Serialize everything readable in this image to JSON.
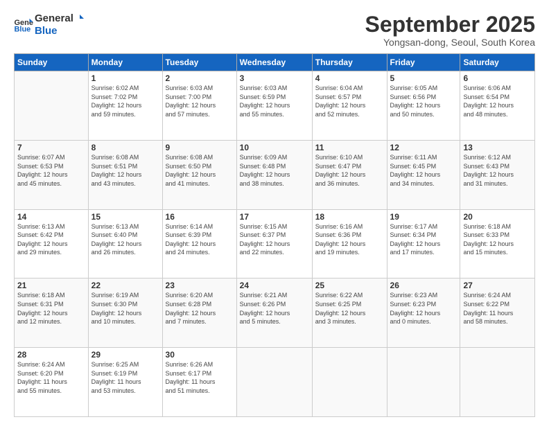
{
  "header": {
    "logo_line1": "General",
    "logo_line2": "Blue",
    "month": "September 2025",
    "location": "Yongsan-dong, Seoul, South Korea"
  },
  "days_of_week": [
    "Sunday",
    "Monday",
    "Tuesday",
    "Wednesday",
    "Thursday",
    "Friday",
    "Saturday"
  ],
  "weeks": [
    [
      {
        "day": "",
        "info": ""
      },
      {
        "day": "1",
        "info": "Sunrise: 6:02 AM\nSunset: 7:02 PM\nDaylight: 12 hours\nand 59 minutes."
      },
      {
        "day": "2",
        "info": "Sunrise: 6:03 AM\nSunset: 7:00 PM\nDaylight: 12 hours\nand 57 minutes."
      },
      {
        "day": "3",
        "info": "Sunrise: 6:03 AM\nSunset: 6:59 PM\nDaylight: 12 hours\nand 55 minutes."
      },
      {
        "day": "4",
        "info": "Sunrise: 6:04 AM\nSunset: 6:57 PM\nDaylight: 12 hours\nand 52 minutes."
      },
      {
        "day": "5",
        "info": "Sunrise: 6:05 AM\nSunset: 6:56 PM\nDaylight: 12 hours\nand 50 minutes."
      },
      {
        "day": "6",
        "info": "Sunrise: 6:06 AM\nSunset: 6:54 PM\nDaylight: 12 hours\nand 48 minutes."
      }
    ],
    [
      {
        "day": "7",
        "info": "Sunrise: 6:07 AM\nSunset: 6:53 PM\nDaylight: 12 hours\nand 45 minutes."
      },
      {
        "day": "8",
        "info": "Sunrise: 6:08 AM\nSunset: 6:51 PM\nDaylight: 12 hours\nand 43 minutes."
      },
      {
        "day": "9",
        "info": "Sunrise: 6:08 AM\nSunset: 6:50 PM\nDaylight: 12 hours\nand 41 minutes."
      },
      {
        "day": "10",
        "info": "Sunrise: 6:09 AM\nSunset: 6:48 PM\nDaylight: 12 hours\nand 38 minutes."
      },
      {
        "day": "11",
        "info": "Sunrise: 6:10 AM\nSunset: 6:47 PM\nDaylight: 12 hours\nand 36 minutes."
      },
      {
        "day": "12",
        "info": "Sunrise: 6:11 AM\nSunset: 6:45 PM\nDaylight: 12 hours\nand 34 minutes."
      },
      {
        "day": "13",
        "info": "Sunrise: 6:12 AM\nSunset: 6:43 PM\nDaylight: 12 hours\nand 31 minutes."
      }
    ],
    [
      {
        "day": "14",
        "info": "Sunrise: 6:13 AM\nSunset: 6:42 PM\nDaylight: 12 hours\nand 29 minutes."
      },
      {
        "day": "15",
        "info": "Sunrise: 6:13 AM\nSunset: 6:40 PM\nDaylight: 12 hours\nand 26 minutes."
      },
      {
        "day": "16",
        "info": "Sunrise: 6:14 AM\nSunset: 6:39 PM\nDaylight: 12 hours\nand 24 minutes."
      },
      {
        "day": "17",
        "info": "Sunrise: 6:15 AM\nSunset: 6:37 PM\nDaylight: 12 hours\nand 22 minutes."
      },
      {
        "day": "18",
        "info": "Sunrise: 6:16 AM\nSunset: 6:36 PM\nDaylight: 12 hours\nand 19 minutes."
      },
      {
        "day": "19",
        "info": "Sunrise: 6:17 AM\nSunset: 6:34 PM\nDaylight: 12 hours\nand 17 minutes."
      },
      {
        "day": "20",
        "info": "Sunrise: 6:18 AM\nSunset: 6:33 PM\nDaylight: 12 hours\nand 15 minutes."
      }
    ],
    [
      {
        "day": "21",
        "info": "Sunrise: 6:18 AM\nSunset: 6:31 PM\nDaylight: 12 hours\nand 12 minutes."
      },
      {
        "day": "22",
        "info": "Sunrise: 6:19 AM\nSunset: 6:30 PM\nDaylight: 12 hours\nand 10 minutes."
      },
      {
        "day": "23",
        "info": "Sunrise: 6:20 AM\nSunset: 6:28 PM\nDaylight: 12 hours\nand 7 minutes."
      },
      {
        "day": "24",
        "info": "Sunrise: 6:21 AM\nSunset: 6:26 PM\nDaylight: 12 hours\nand 5 minutes."
      },
      {
        "day": "25",
        "info": "Sunrise: 6:22 AM\nSunset: 6:25 PM\nDaylight: 12 hours\nand 3 minutes."
      },
      {
        "day": "26",
        "info": "Sunrise: 6:23 AM\nSunset: 6:23 PM\nDaylight: 12 hours\nand 0 minutes."
      },
      {
        "day": "27",
        "info": "Sunrise: 6:24 AM\nSunset: 6:22 PM\nDaylight: 11 hours\nand 58 minutes."
      }
    ],
    [
      {
        "day": "28",
        "info": "Sunrise: 6:24 AM\nSunset: 6:20 PM\nDaylight: 11 hours\nand 55 minutes."
      },
      {
        "day": "29",
        "info": "Sunrise: 6:25 AM\nSunset: 6:19 PM\nDaylight: 11 hours\nand 53 minutes."
      },
      {
        "day": "30",
        "info": "Sunrise: 6:26 AM\nSunset: 6:17 PM\nDaylight: 11 hours\nand 51 minutes."
      },
      {
        "day": "",
        "info": ""
      },
      {
        "day": "",
        "info": ""
      },
      {
        "day": "",
        "info": ""
      },
      {
        "day": "",
        "info": ""
      }
    ]
  ]
}
